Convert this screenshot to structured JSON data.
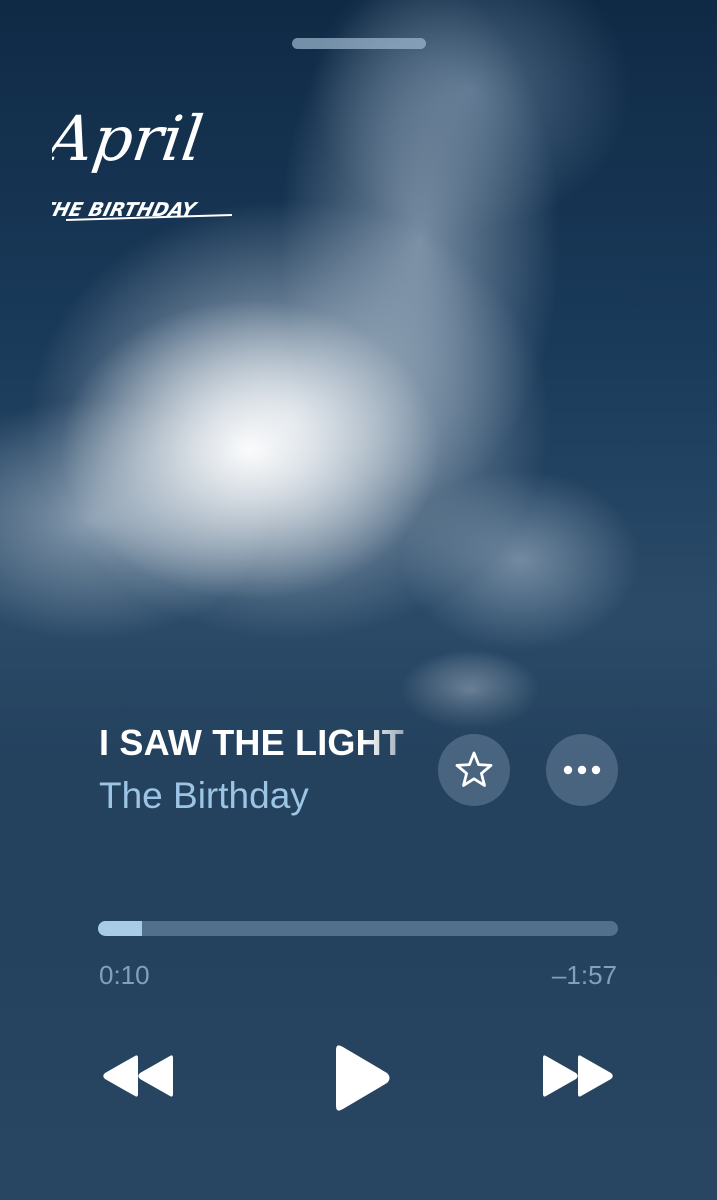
{
  "logo": {
    "title": "April",
    "subtitle": "THE BIRTHDAY"
  },
  "now_playing": {
    "title": "I SAW THE LIGHT",
    "artist": "The Birthday"
  },
  "progress": {
    "elapsed": "0:10",
    "remaining": "–1:57",
    "fraction": 0.085
  },
  "icons": {
    "favorite": "star-icon",
    "more": "ellipsis-icon",
    "previous": "rewind-icon",
    "play": "play-icon",
    "next": "fast-forward-icon"
  },
  "colors": {
    "title": "#ffffff",
    "artist": "#9cc4e4",
    "progress_fill": "#a9cbe3"
  }
}
